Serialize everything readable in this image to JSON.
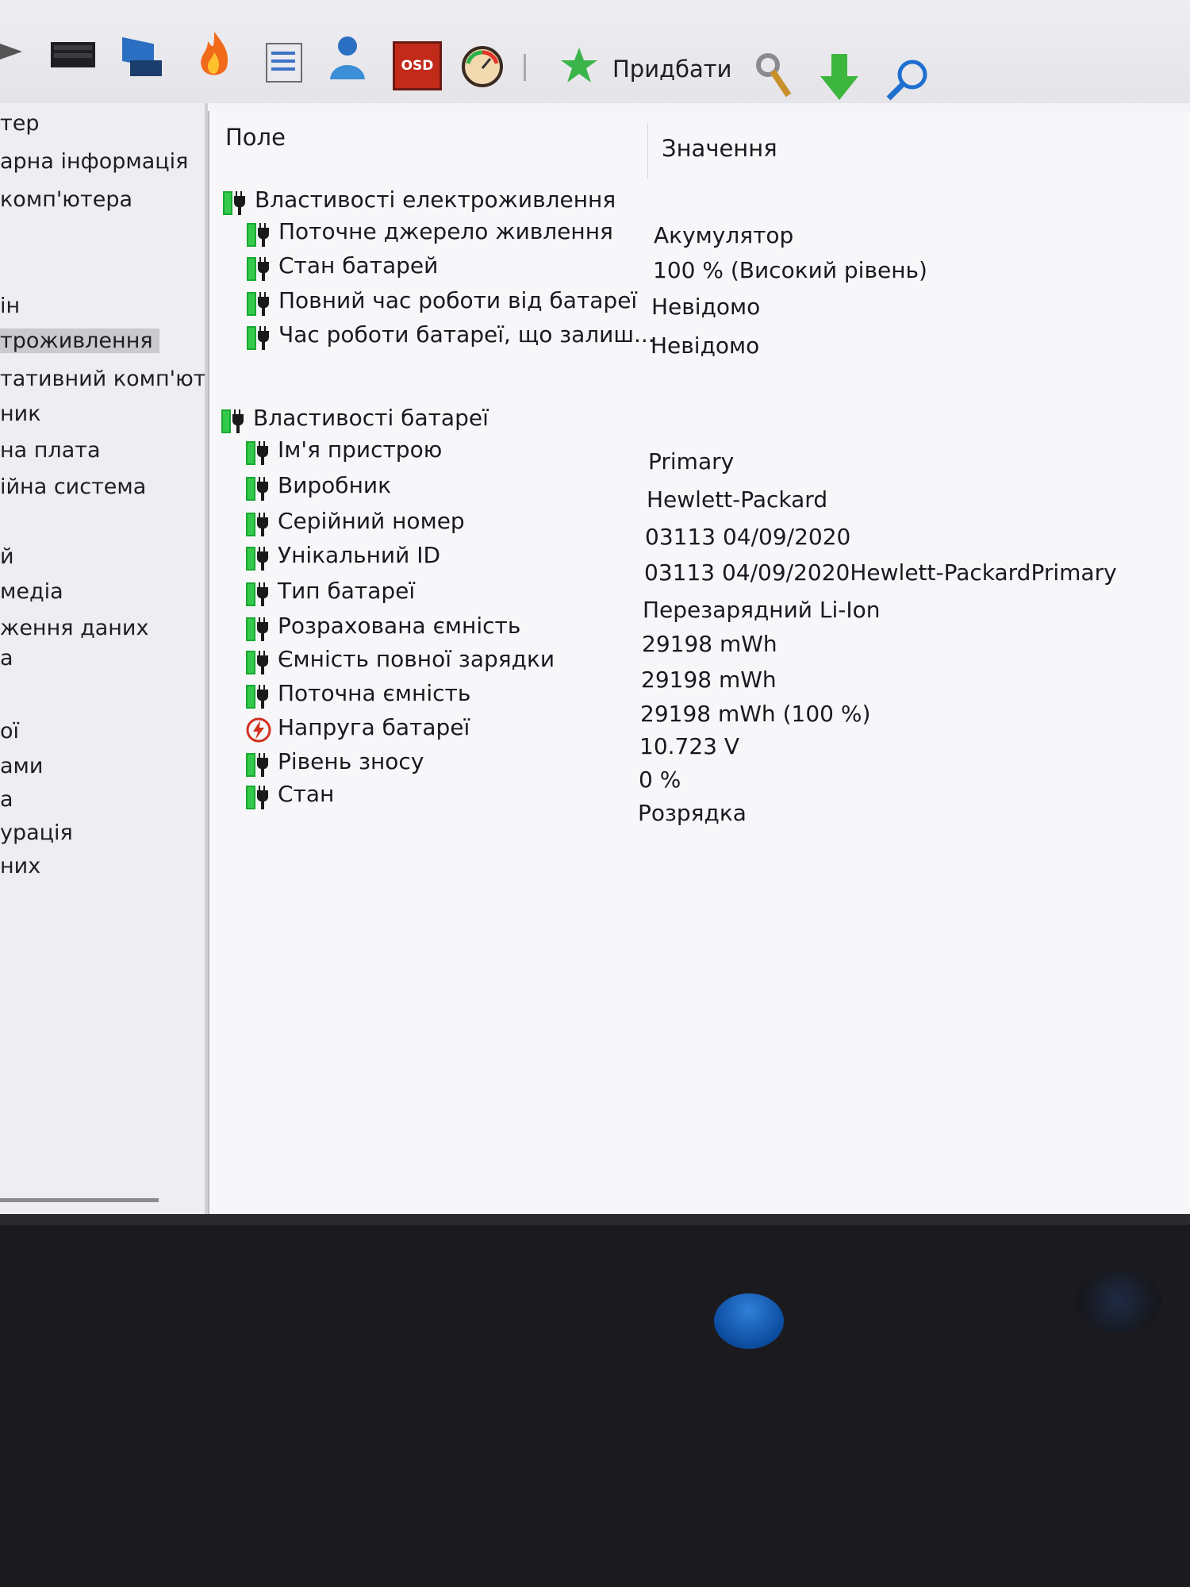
{
  "toolbar": {
    "icons": [
      "arrow-icon",
      "report-icon",
      "computer-icon",
      "flame-icon",
      "schedule-icon",
      "user-icon",
      "osd-icon",
      "gauge-icon",
      "buy-icon",
      "tools-icon",
      "download-icon",
      "search-icon"
    ],
    "osd_label": "OSD",
    "buy_label": "Придбати"
  },
  "sidebar": {
    "items": [
      "тер",
      "арна інформація",
      "комп'ютера",
      "ін",
      "троживлення",
      "тативний комп'юте",
      "ник",
      "на плата",
      "ійна система",
      "й",
      "медіа",
      "ження даних",
      "а",
      "ої",
      "ами",
      "а",
      "урація",
      "них"
    ],
    "selected": "троживлення"
  },
  "table": {
    "col_field": "Поле",
    "col_value": "Значення",
    "sections": [
      {
        "title": "Властивості електроживлення",
        "icon": "battery-plug-icon",
        "rows": [
          {
            "field": "Поточне джерело живлення",
            "value": "Акумулятор",
            "icon": "battery-plug-icon"
          },
          {
            "field": "Стан батарей",
            "value": "100 % (Високий рівень)",
            "icon": "battery-plug-icon"
          },
          {
            "field": "Повний час роботи від батареї",
            "value": "Невідомо",
            "icon": "battery-plug-icon"
          },
          {
            "field": "Час роботи батареї, що залиш...",
            "value": "Невідомо",
            "icon": "battery-plug-icon"
          }
        ]
      },
      {
        "title": "Властивості батареї",
        "icon": "battery-plug-icon",
        "rows": [
          {
            "field": "Ім'я пристрою",
            "value": "Primary",
            "icon": "battery-plug-icon"
          },
          {
            "field": "Виробник",
            "value": "Hewlett-Packard",
            "icon": "battery-plug-icon"
          },
          {
            "field": "Серійний номер",
            "value": "03113 04/09/2020",
            "icon": "battery-plug-icon"
          },
          {
            "field": "Унікальний ID",
            "value": "03113 04/09/2020Hewlett-PackardPrimary",
            "icon": "battery-plug-icon"
          },
          {
            "field": "Тип батареї",
            "value": "Перезарядний Li-Ion",
            "icon": "battery-plug-icon"
          },
          {
            "field": "Розрахована ємність",
            "value": "29198 mWh",
            "icon": "battery-plug-icon"
          },
          {
            "field": "Ємність повної зарядки",
            "value": "29198 mWh",
            "icon": "battery-plug-icon"
          },
          {
            "field": "Поточна ємність",
            "value": "29198 mWh  (100 %)",
            "icon": "battery-plug-icon"
          },
          {
            "field": "Напруга батареї",
            "value": "10.723 V",
            "icon": "voltage-icon"
          },
          {
            "field": "Рівень зносу",
            "value": "0 %",
            "icon": "battery-plug-icon"
          },
          {
            "field": "Стан",
            "value": "Розрядка",
            "icon": "battery-plug-icon"
          }
        ]
      }
    ]
  },
  "colors": {
    "battery_green": "#19a832",
    "voltage_red": "#d2301e",
    "selection": "#c9c9ce"
  }
}
